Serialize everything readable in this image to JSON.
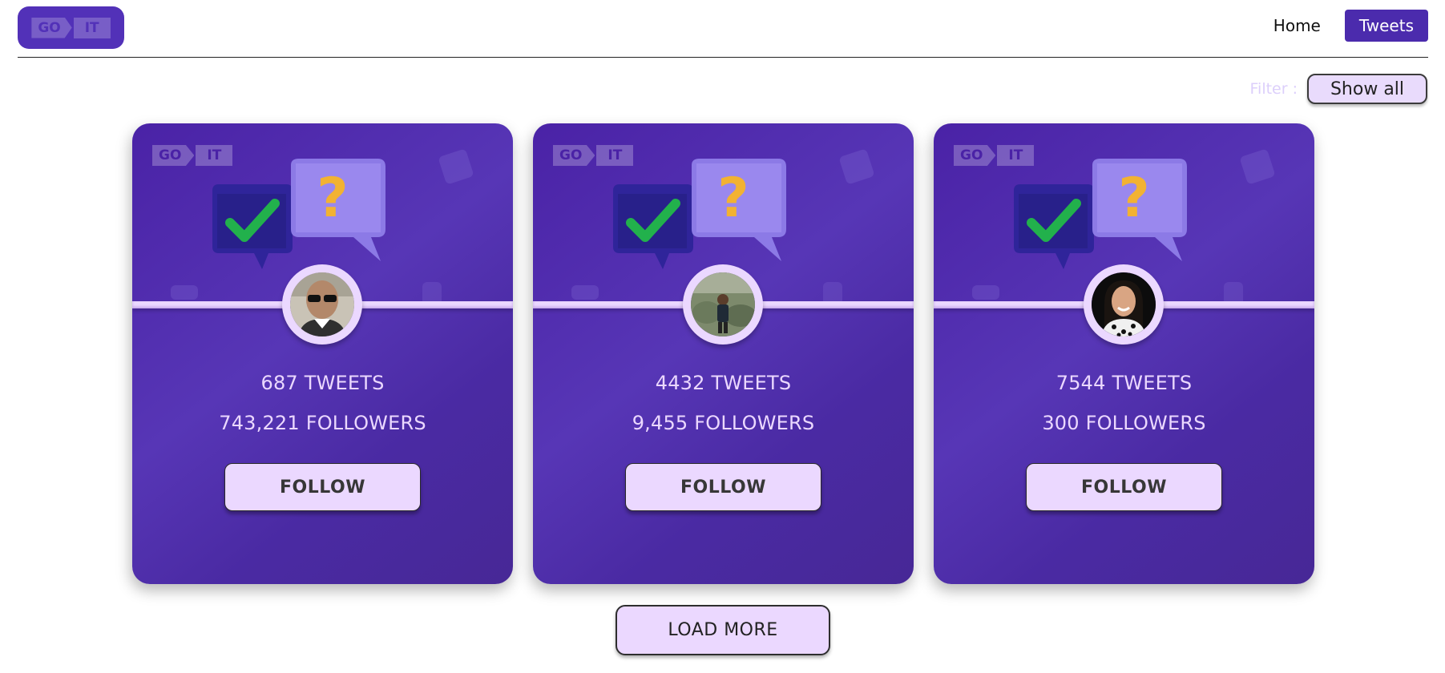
{
  "header": {
    "logo": {
      "part1": "GO",
      "part2": "IT"
    },
    "nav": [
      {
        "label": "Home",
        "active": false
      },
      {
        "label": "Tweets",
        "active": true
      }
    ]
  },
  "filter": {
    "label": "Filter :",
    "selected": "Show all"
  },
  "cards": [
    {
      "tweets": "687 TWEETS",
      "followers": "743,221 FOLLOWERS",
      "button": "FOLLOW",
      "logo_part1": "GO",
      "logo_part2": "IT",
      "avatar": "man-with-sunglasses"
    },
    {
      "tweets": "4432 TWEETS",
      "followers": "9,455 FOLLOWERS",
      "button": "FOLLOW",
      "logo_part1": "GO",
      "logo_part2": "IT",
      "avatar": "person-in-field"
    },
    {
      "tweets": "7544 TWEETS",
      "followers": "300 FOLLOWERS",
      "button": "FOLLOW",
      "logo_part1": "GO",
      "logo_part2": "IT",
      "avatar": "woman-smiling"
    }
  ],
  "load_more": "LOAD MORE",
  "colors": {
    "brand": "#4b2bad",
    "card_bg": "#5736b6",
    "button_bg": "#ebd8ff",
    "check_green": "#22b14c",
    "question_gold": "#f2b232"
  }
}
